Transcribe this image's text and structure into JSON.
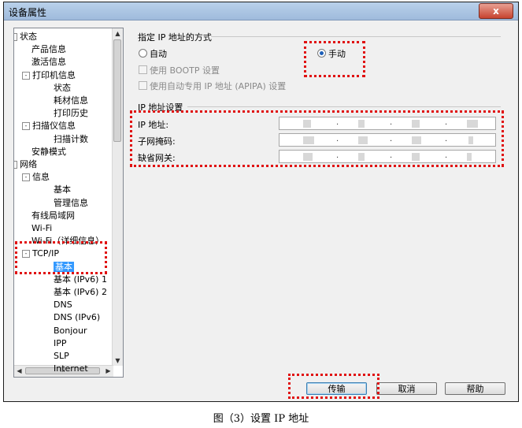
{
  "window": {
    "title": "设备属性",
    "close_glyph": "x"
  },
  "tree": {
    "items": [
      {
        "label": "状态",
        "level": 0,
        "toggle": "-"
      },
      {
        "label": "产品信息",
        "level": 1
      },
      {
        "label": "激活信息",
        "level": 1
      },
      {
        "label": "打印机信息",
        "level": 1,
        "toggle": "-"
      },
      {
        "label": "状态",
        "level": 2
      },
      {
        "label": "耗材信息",
        "level": 2
      },
      {
        "label": "打印历史",
        "level": 2
      },
      {
        "label": "扫描仪信息",
        "level": 1,
        "toggle": "-"
      },
      {
        "label": "扫描计数",
        "level": 2
      },
      {
        "label": "安静模式",
        "level": 1
      },
      {
        "label": "网络",
        "level": 0,
        "toggle": "-"
      },
      {
        "label": "信息",
        "level": 1,
        "toggle": "-"
      },
      {
        "label": "基本",
        "level": 2
      },
      {
        "label": "管理信息",
        "level": 2
      },
      {
        "label": "有线局域网",
        "level": 1
      },
      {
        "label": "Wi-Fi",
        "level": 1
      },
      {
        "label": "Wi-Fi（详细信息）",
        "level": 1
      },
      {
        "label": "TCP/IP",
        "level": 1,
        "toggle": "-"
      },
      {
        "label": "基本",
        "level": 2,
        "selected": true
      },
      {
        "label": "基本 (IPv6) 1",
        "level": 2
      },
      {
        "label": "基本 (IPv6) 2",
        "level": 2
      },
      {
        "label": "DNS",
        "level": 2
      },
      {
        "label": "DNS (IPv6)",
        "level": 2
      },
      {
        "label": "Bonjour",
        "level": 2
      },
      {
        "label": "IPP",
        "level": 2
      },
      {
        "label": "SLP",
        "level": 2
      },
      {
        "label": "Internet",
        "level": 2
      }
    ],
    "hscroll_thumb": "III"
  },
  "ip_method": {
    "title": "指定 IP 地址的方式",
    "auto_label": "自动",
    "manual_label": "手动",
    "selected": "manual",
    "bootp_label": "使用 BOOTP 设置",
    "apipa_label": "使用自动专用 IP 地址 (APIPA) 设置"
  },
  "ip_settings": {
    "title": "IP 地址设置",
    "rows": [
      {
        "label": "IP 地址:"
      },
      {
        "label": "子网掩码:"
      },
      {
        "label": "缺省网关:"
      }
    ]
  },
  "buttons": {
    "transmit": "传输",
    "cancel": "取消",
    "help": "帮助"
  },
  "caption": "图（3）设置 IP 地址"
}
